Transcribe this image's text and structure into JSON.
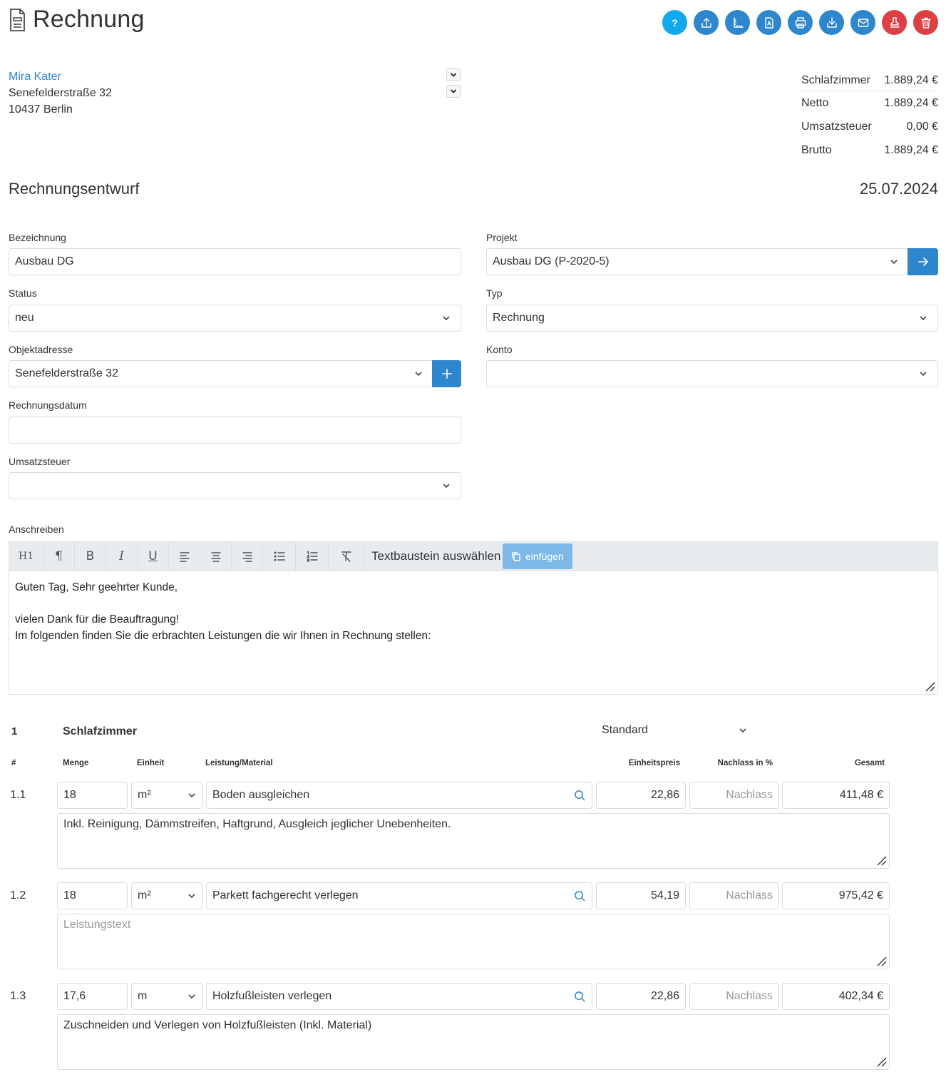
{
  "header": {
    "title": "Rechnung",
    "toolbar": [
      {
        "icon": "help-icon",
        "label": "?"
      },
      {
        "icon": "upload-icon"
      },
      {
        "icon": "measure-icon"
      },
      {
        "icon": "pdf-icon"
      },
      {
        "icon": "print-icon"
      },
      {
        "icon": "download-icon"
      },
      {
        "icon": "mail-icon"
      },
      {
        "icon": "stamp-icon"
      },
      {
        "icon": "trash-icon"
      }
    ]
  },
  "customer": {
    "name": "Mira Kater",
    "street": "Senefelderstraße 32",
    "city": "10437 Berlin"
  },
  "summary": [
    {
      "label": "Schlafzimmer",
      "value": "1.889,24 €"
    },
    {
      "label": "Netto",
      "value": "1.889,24 €"
    },
    {
      "label": "Umsatzsteuer",
      "value": "0,00 €"
    },
    {
      "label": "Brutto",
      "value": "1.889,24 €"
    }
  ],
  "document": {
    "status_title": "Rechnungsentwurf",
    "date": "25.07.2024"
  },
  "form": {
    "bezeichnung": {
      "label": "Bezeichnung",
      "value": "Ausbau DG"
    },
    "projekt": {
      "label": "Projekt",
      "value": "Ausbau DG (P-2020-5)"
    },
    "status": {
      "label": "Status",
      "value": "neu"
    },
    "typ": {
      "label": "Typ",
      "value": "Rechnung"
    },
    "objektadresse": {
      "label": "Objektadresse",
      "value": "Senefelderstraße 32"
    },
    "konto": {
      "label": "Konto",
      "value": ""
    },
    "rechnungsdatum": {
      "label": "Rechnungsdatum",
      "value": ""
    },
    "umsatzsteuer": {
      "label": "Umsatzsteuer",
      "value": ""
    }
  },
  "editor": {
    "label": "Anschreiben",
    "tools": [
      "H1",
      "¶",
      "B",
      "I",
      "U"
    ],
    "textbaustein": "Textbaustein auswählen",
    "insert_label": "einfügen",
    "lines": [
      "Guten Tag, Sehr geehrter Kunde,",
      "",
      "vielen Dank für die Beauftragung!",
      "Im folgenden finden Sie die erbrachten Leistungen die wir Ihnen in Rechnung stellen:"
    ]
  },
  "section": {
    "number": "1",
    "name": "Schlafzimmer",
    "type": "Standard"
  },
  "table_headers": {
    "num": "#",
    "menge": "Menge",
    "einheit": "Einheit",
    "leistung": "Leistung/Material",
    "einheitspreis": "Einheitspreis",
    "nachlass": "Nachlass in %",
    "gesamt": "Gesamt"
  },
  "items": [
    {
      "num": "1.1",
      "menge": "18",
      "einheit": "m²",
      "leistung": "Boden ausgleichen",
      "preis": "22,86",
      "nachlass_placeholder": "Nachlass",
      "gesamt": "411,48 €",
      "text": "Inkl. Reinigung, Dämmstreifen, Haftgrund, Ausgleich jeglicher Unebenheiten.",
      "text_placeholder": ""
    },
    {
      "num": "1.2",
      "menge": "18",
      "einheit": "m²",
      "leistung": "Parkett fachgerecht verlegen",
      "preis": "54,19",
      "nachlass_placeholder": "Nachlass",
      "gesamt": "975,42 €",
      "text": "",
      "text_placeholder": "Leistungstext"
    },
    {
      "num": "1.3",
      "menge": "17,6",
      "einheit": "m",
      "leistung": "Holzfußleisten verlegen",
      "preis": "22,86",
      "nachlass_placeholder": "Nachlass",
      "gesamt": "402,34 €",
      "text": "Zuschneiden und Verlegen von Holzfußleisten (Inkl. Material)",
      "text_placeholder": ""
    }
  ],
  "colors": {
    "primary": "#2e87cc",
    "help": "#12a9ec",
    "danger": "#dc3f44",
    "toolbar_bg": "#e9ecef"
  }
}
